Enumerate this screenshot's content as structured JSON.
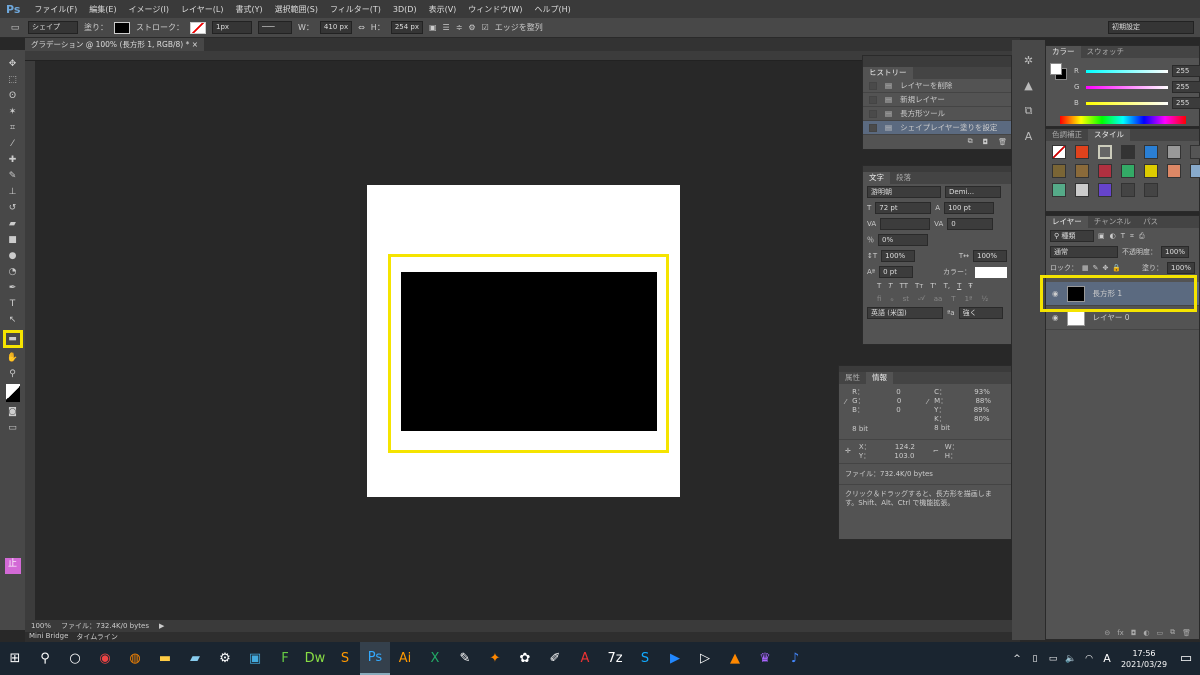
{
  "menu": {
    "logo": "Ps",
    "items": [
      "ファイル(F)",
      "編集(E)",
      "イメージ(I)",
      "レイヤー(L)",
      "書式(Y)",
      "選択範囲(S)",
      "フィルター(T)",
      "3D(D)",
      "表示(V)",
      "ウィンドウ(W)",
      "ヘルプ(H)"
    ]
  },
  "options": {
    "mode": "シェイプ",
    "fill_label": "塗り：",
    "stroke_label": "ストローク：",
    "stroke_width": "1px",
    "w_label": "W：",
    "w": "410 px",
    "h_label": "H：",
    "h": "254 px",
    "align_edges": "エッジを整列",
    "workspace": "初期設定"
  },
  "document": {
    "tab": "グラデーション @ 100% (長方形 1, RGB/8) *",
    "close": "×"
  },
  "status": {
    "zoom": "100%",
    "file": "ファイル：732.4K/0 bytes"
  },
  "bottom_tabs": [
    "Mini Bridge",
    "タイムライン"
  ],
  "history": {
    "tab": "ヒストリー",
    "items": [
      "レイヤーを削除",
      "新規レイヤー",
      "長方形ツール",
      "シェイプレイヤー塗りを設定"
    ],
    "selected": 3
  },
  "character": {
    "tabs": [
      "文字",
      "段落"
    ],
    "font": "游明朝",
    "style": "Demi...",
    "size": "72 pt",
    "leading": "100 pt",
    "kerning": "",
    "tracking": "0",
    "tsume": "0%",
    "vscale": "100%",
    "hscale": "100%",
    "baseline": "0 pt",
    "color_label": "カラー：",
    "language": "英語 (米国)",
    "aa_label": "ªa",
    "aa": "強く",
    "type_styles": [
      "T",
      "T",
      "TT",
      "Tт",
      "T'",
      "T,",
      "T",
      "Ŧ"
    ]
  },
  "info": {
    "tabs": [
      "属性",
      "情報"
    ],
    "r": "0",
    "g": "0",
    "b": "0",
    "c": "93%",
    "m": "88%",
    "y": "89%",
    "k": "80%",
    "bit1": "8 bit",
    "bit2": "8 bit",
    "x": "124.2",
    "y_pos": "103.0",
    "w": "",
    "h": "",
    "file": "ファイル：732.4K/0 bytes",
    "hint": "クリック＆ドラッグすると、長方形を描画します。Shift、Alt、Ctrl で機能拡張。",
    "labels": {
      "r": "R：",
      "g": "G：",
      "b": "B：",
      "c": "C：",
      "m": "M：",
      "y": "Y：",
      "k": "K：",
      "x": "X：",
      "yy": "Y：",
      "w": "W：",
      "h": "H："
    }
  },
  "color": {
    "tabs": [
      "カラー",
      "スウォッチ"
    ],
    "r": "255",
    "g": "255",
    "b": "255",
    "labels": [
      "R",
      "G",
      "B"
    ]
  },
  "styles": {
    "tabs": [
      "色調補正",
      "スタイル"
    ]
  },
  "layers": {
    "tabs": [
      "レイヤー",
      "チャンネル",
      "パス"
    ],
    "filter": "種類",
    "blend": "通常",
    "opacity_label": "不透明度：",
    "opacity": "100%",
    "lock_label": "ロック：",
    "fill_label": "塗り：",
    "fill": "100%",
    "items": [
      {
        "name": "長方形 1",
        "selected": true
      },
      {
        "name": "レイヤー 0",
        "selected": false
      }
    ]
  },
  "taskbar": {
    "time": "17:56",
    "date": "2021/03/29",
    "ime": "A"
  },
  "colors": {
    "highlight": "#f5e400",
    "selection": "#5b6a80"
  }
}
